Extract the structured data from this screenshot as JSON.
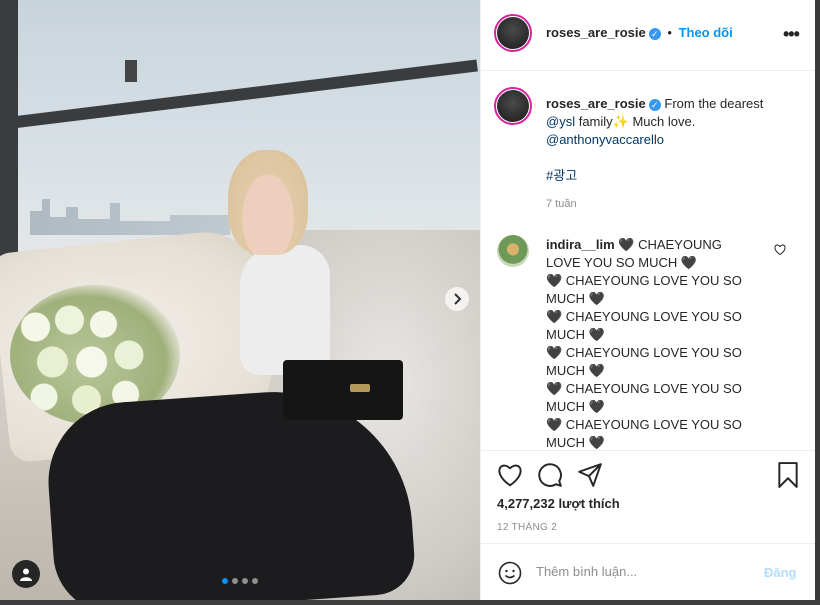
{
  "post": {
    "author": "roses_are_rosie",
    "follow_label": "Theo dõi",
    "separator": "•",
    "more_label": "•••"
  },
  "caption": {
    "author": "roses_are_rosie",
    "text": "From the dearest",
    "mention1": "@ysl",
    "text2": "family✨ Much love.",
    "mention2": "@anthonyvaccarello",
    "hashtag": "#광고",
    "time": "7 tuần"
  },
  "comment": {
    "author": "indira__lim",
    "lines": [
      "🖤 CHAEYOUNG LOVE YOU SO MUCH 🖤",
      "🖤 CHAEYOUNG LOVE YOU SO MUCH 🖤",
      "🖤 CHAEYOUNG LOVE YOU SO MUCH 🖤",
      "🖤 CHAEYOUNG LOVE YOU SO MUCH 🖤",
      "🖤 CHAEYOUNG LOVE YOU SO MUCH 🖤",
      "🖤 CHAEYOUNG LOVE YOU SO MUCH 🖤"
    ]
  },
  "stats": {
    "likes": "4,277,232 lượt thích",
    "date": "12 THÁNG 2"
  },
  "composer": {
    "placeholder": "Thêm bình luận...",
    "post_label": "Đăng"
  },
  "carousel": {
    "count": 4,
    "active_index": 0
  },
  "colors": {
    "accent": "#0095f6",
    "verified": "#3897f0",
    "post_disabled": "#b2dffc"
  },
  "icons": [
    "verified-badge-icon",
    "more-options-icon",
    "chevron-right-icon",
    "user-tag-icon",
    "heart-icon",
    "comment-icon",
    "share-icon",
    "bookmark-icon",
    "emoji-icon"
  ]
}
